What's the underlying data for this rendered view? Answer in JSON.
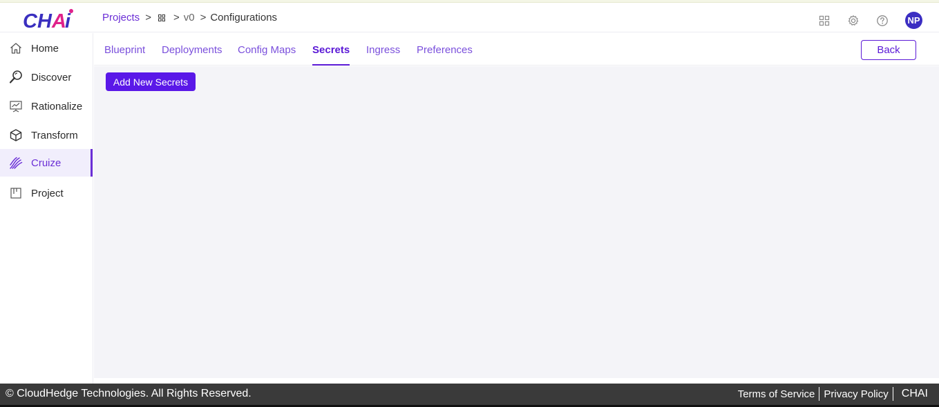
{
  "app": {
    "logo_text": "CHAi"
  },
  "breadcrumb": {
    "projects": "Projects",
    "version": "v0",
    "current": "Configurations"
  },
  "header": {
    "icons": [
      "apps-grid-icon",
      "settings-gear-icon",
      "help-icon"
    ],
    "avatar_initials": "NP"
  },
  "sidebar": {
    "items": [
      {
        "label": "Home",
        "icon": "home-icon"
      },
      {
        "label": "Discover",
        "icon": "discover-icon"
      },
      {
        "label": "Rationalize",
        "icon": "rationalize-icon"
      },
      {
        "label": "Transform",
        "icon": "transform-cube-icon"
      },
      {
        "label": "Cruize",
        "icon": "cruize-icon",
        "active": true
      },
      {
        "label": "Project",
        "icon": "project-board-icon"
      }
    ]
  },
  "tabs": [
    {
      "label": "Blueprint"
    },
    {
      "label": "Deployments"
    },
    {
      "label": "Config Maps"
    },
    {
      "label": "Secrets",
      "active": true
    },
    {
      "label": "Ingress"
    },
    {
      "label": "Preferences"
    }
  ],
  "actions": {
    "back_label": "Back",
    "add_secrets_label": "Add New Secrets"
  },
  "footer": {
    "copyright": "© CloudHedge Technologies. All Rights Reserved.",
    "terms": "Terms of Service",
    "privacy": "Privacy Policy",
    "brand": "CHAI"
  },
  "colors": {
    "accent": "#5a18d6",
    "button": "#5a18e8",
    "avatar": "#3b2ec2",
    "footer_bg": "#3a3a3a",
    "content_bg": "#f4f4f8"
  }
}
